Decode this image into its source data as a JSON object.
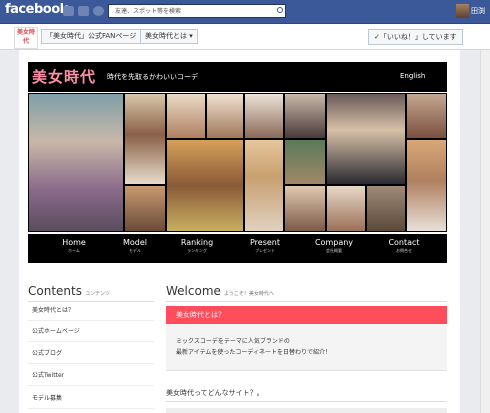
{
  "facebook": {
    "logo": "facebook",
    "search_placeholder": "友達、スポット等を検索",
    "user_name": "田渕"
  },
  "page_header": {
    "title_button": "「美女時代」公式FANページ",
    "tab_button": "美女時代とは ▾",
    "like_button": "✓「いいね！」しています",
    "logo_text": "美女時代"
  },
  "banner": {
    "brand": "美女時代",
    "tagline": "時代を先取るかわいいコーデ",
    "english_link": "English"
  },
  "nav": [
    {
      "label": "Home",
      "sub": "ホーム"
    },
    {
      "label": "Model",
      "sub": "モデル"
    },
    {
      "label": "Ranking",
      "sub": "ランキング"
    },
    {
      "label": "Present",
      "sub": "プレゼント"
    },
    {
      "label": "Company",
      "sub": "会社概要"
    },
    {
      "label": "Contact",
      "sub": "お問合せ"
    }
  ],
  "sidebar": {
    "title": "Contents",
    "subtitle": "コンテンツ",
    "items": [
      "美女時代とは？",
      "公式ホームページ",
      "公式ブログ",
      "公式Twitter",
      "モデル募集"
    ]
  },
  "welcome": {
    "title": "Welcome",
    "subtitle": "ようこそ！美女時代へ",
    "what_title": "美女時代とは？",
    "desc_line1": "ミックスコーデをテーマに人気ブランドの",
    "desc_line2": "最新アイテムを使ったコーディネートを日替わりで紹介！",
    "question": "美女時代ってどんなサイト？。"
  },
  "colors": {
    "facebook_blue": "#3b5998",
    "accent_red": "#ff4d5c",
    "brand_pink": "#ff8fa6"
  }
}
